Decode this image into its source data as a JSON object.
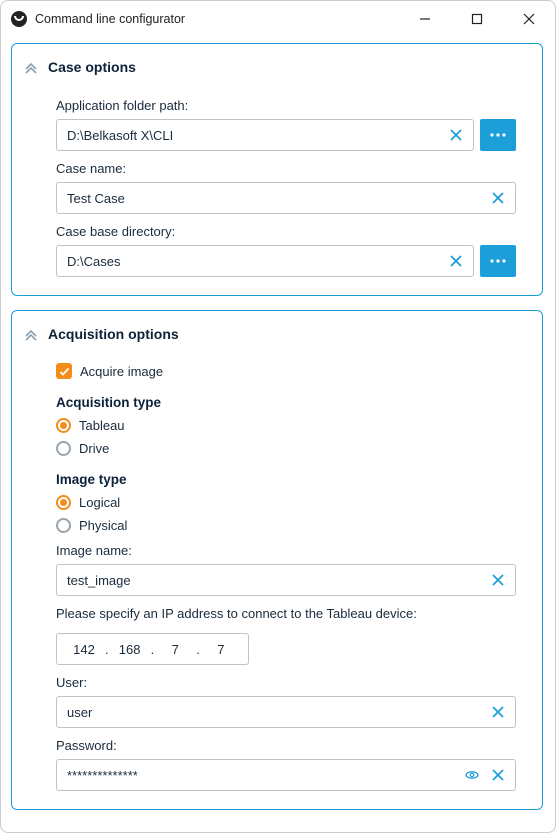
{
  "window": {
    "title": "Command line configurator"
  },
  "case_options": {
    "title": "Case options",
    "app_folder_label": "Application folder path:",
    "app_folder_value": "D:\\Belkasoft X\\CLI",
    "case_name_label": "Case name:",
    "case_name_value": "Test Case",
    "case_base_dir_label": "Case base directory:",
    "case_base_dir_value": "D:\\Cases"
  },
  "acquisition": {
    "title": "Acquisition options",
    "acquire_image_label": "Acquire image",
    "acquire_image_checked": true,
    "type_heading": "Acquisition type",
    "type_options": {
      "tableau": "Tableau",
      "drive": "Drive"
    },
    "type_selected": "tableau",
    "image_type_heading": "Image type",
    "image_type_options": {
      "logical": "Logical",
      "physical": "Physical"
    },
    "image_type_selected": "logical",
    "image_name_label": "Image name:",
    "image_name_value": "test_image",
    "ip_label": "Please specify an IP address to connect to the Tableau device:",
    "ip": {
      "o1": "142",
      "o2": "168",
      "o3": "7",
      "o4": "7"
    },
    "user_label": "User:",
    "user_value": "user",
    "password_label": "Password:",
    "password_value": "**************"
  },
  "colors": {
    "accent_blue": "#1C9ED9",
    "accent_orange": "#F28C1B"
  }
}
